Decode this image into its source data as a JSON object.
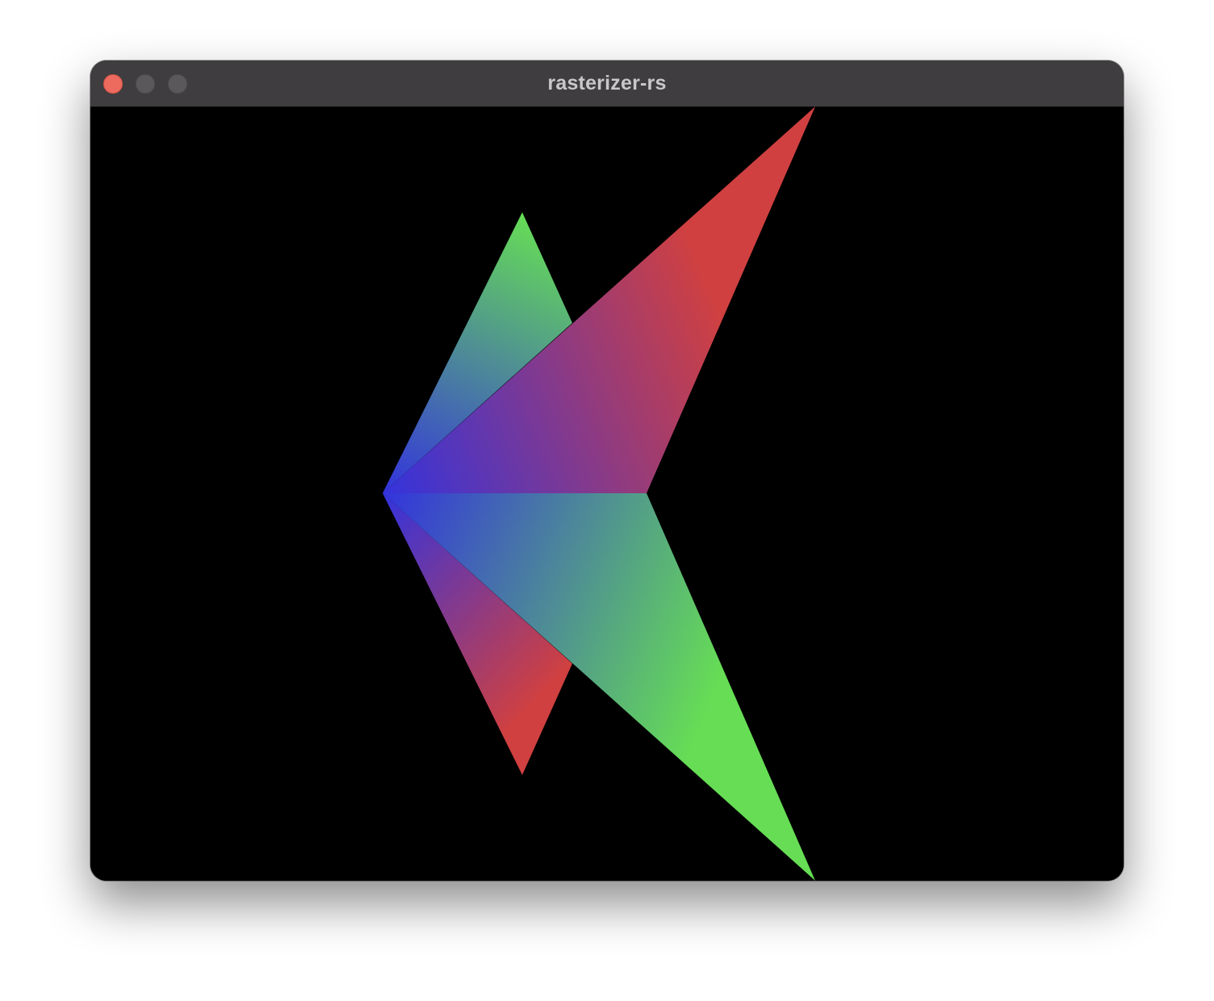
{
  "window": {
    "title": "rasterizer-rs"
  },
  "controls": {
    "close": "close-button",
    "minimize": "minimize-button",
    "zoom": "zoom-button"
  },
  "colors": {
    "canvas_background": "#000000",
    "titlebar": "#3f3d3f",
    "title_text": "#c9c7c9",
    "close": "#ed6a5e",
    "inactive_button": "#5a585a",
    "vertex_red": "#d04040",
    "vertex_green": "#66dd55",
    "vertex_blue": "#3333dd"
  }
}
